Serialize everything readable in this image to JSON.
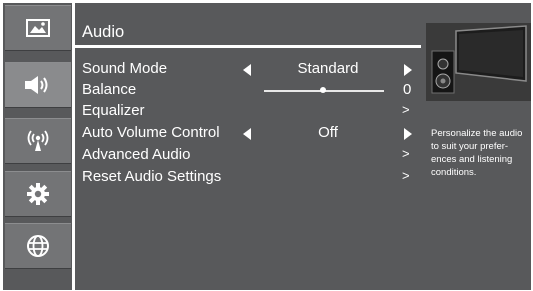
{
  "sidebar": {
    "items": [
      {
        "name": "picture",
        "icon": "picture-icon"
      },
      {
        "name": "audio",
        "icon": "speaker-icon",
        "active": true
      },
      {
        "name": "network",
        "icon": "broadcast-icon"
      },
      {
        "name": "settings",
        "icon": "gear-icon"
      },
      {
        "name": "internet",
        "icon": "globe-icon"
      }
    ]
  },
  "header": {
    "title": "Audio"
  },
  "menu": {
    "sound_mode": {
      "label": "Sound Mode",
      "value": "Standard"
    },
    "balance": {
      "label": "Balance",
      "value": "0",
      "level": 0.5
    },
    "equalizer": {
      "label": "Equalizer",
      "chevron": ">"
    },
    "auto_volume": {
      "label": "Auto Volume Control",
      "value": "Off"
    },
    "advanced_audio": {
      "label": "Advanced Audio",
      "chevron": ">"
    },
    "reset_audio": {
      "label": "Reset Audio Settings",
      "chevron": ">"
    }
  },
  "help": {
    "text": "Personalize the audio to suit your prefer-ences and listening conditions."
  },
  "colors": {
    "background": "#58595b",
    "sidebar": "#737476",
    "text": "#ffffff"
  }
}
